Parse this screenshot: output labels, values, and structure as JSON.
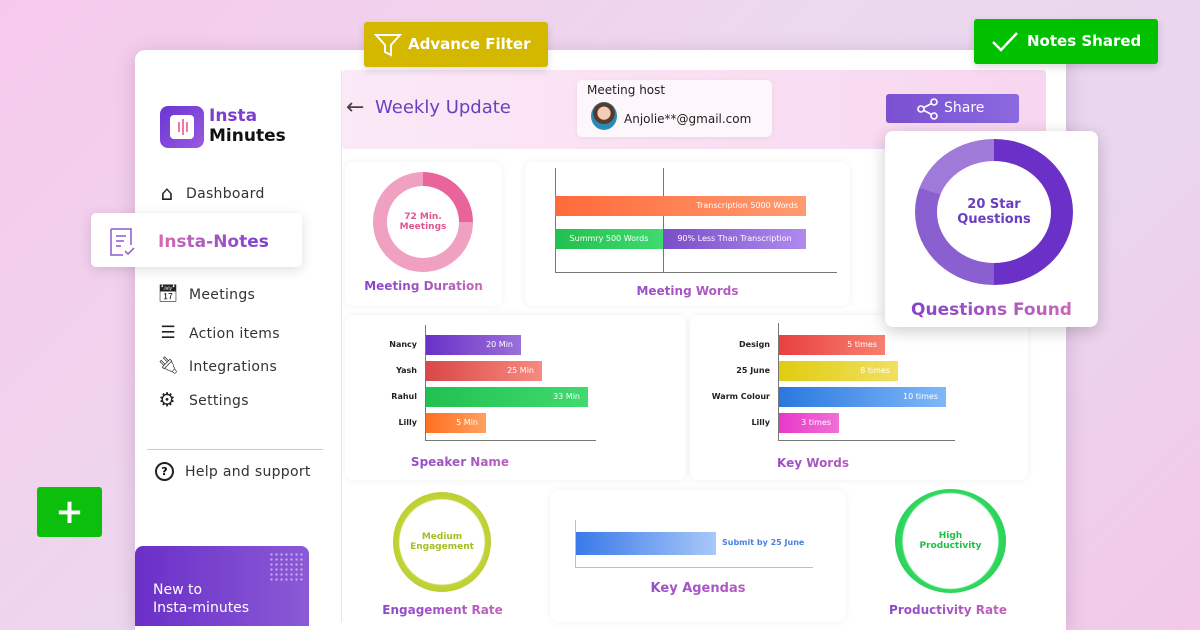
{
  "floating": {
    "advance_filter": "Advance Filter",
    "notes_shared": "Notes Shared",
    "add_icon": "plus-icon"
  },
  "sidebar": {
    "logo_line1": "Insta",
    "logo_line2": "Minutes",
    "items": [
      {
        "label": "Dashboard",
        "icon": "home-icon"
      },
      {
        "label": "Insta-Notes",
        "icon": "notes-icon",
        "active": true
      },
      {
        "label": "Meetings",
        "icon": "calendar-icon"
      },
      {
        "label": "Action items",
        "icon": "list-icon"
      },
      {
        "label": "Integrations",
        "icon": "plug-icon"
      },
      {
        "label": "Settings",
        "icon": "gear-icon"
      }
    ],
    "help": "Help and support",
    "promo_line1": "New to",
    "promo_line2": "Insta-minutes"
  },
  "header": {
    "title": "Weekly Update",
    "host_label": "Meeting host",
    "host_email": "Anjolie**@gmail.com",
    "share": "Share"
  },
  "colors": {
    "accent": "#6a3fc0",
    "filter": "#d4b800",
    "success": "#00c000"
  },
  "cards": {
    "meeting_duration": {
      "title": "Meeting Duration",
      "center_line1": "72 Min.",
      "center_line2": "Meetings"
    },
    "meeting_words": {
      "title": "Meeting Words",
      "transcription": "Transcription  5000 Words",
      "summary": "Summry 500 Words",
      "reduction": "90% Less Than Transcription"
    },
    "questions": {
      "title": "Questions Found",
      "center_line1": "20 Star",
      "center_line2": "Questions"
    },
    "speakers": {
      "title": "Speaker Name",
      "bars": [
        {
          "label": "Nancy",
          "value": "20 Min"
        },
        {
          "label": "Yash",
          "value": "25 Min"
        },
        {
          "label": "Rahul",
          "value": "33 Min"
        },
        {
          "label": "Lilly",
          "value": "5 Min"
        }
      ]
    },
    "keywords": {
      "title": "Key Words",
      "bars": [
        {
          "label": "Design",
          "value": "5 times"
        },
        {
          "label": "25 June",
          "value": "8 times"
        },
        {
          "label": "Warm Colour",
          "value": "10 times"
        },
        {
          "label": "Lilly",
          "value": "3 times"
        }
      ]
    },
    "engagement": {
      "title": "Engagement Rate",
      "center_line1": "Medium",
      "center_line2": "Engagement"
    },
    "agendas": {
      "title": "Key Agendas",
      "item": "Submit by 25 June"
    },
    "productivity": {
      "title": "Productivity Rate",
      "center_line1": "High",
      "center_line2": "Productivity"
    }
  }
}
